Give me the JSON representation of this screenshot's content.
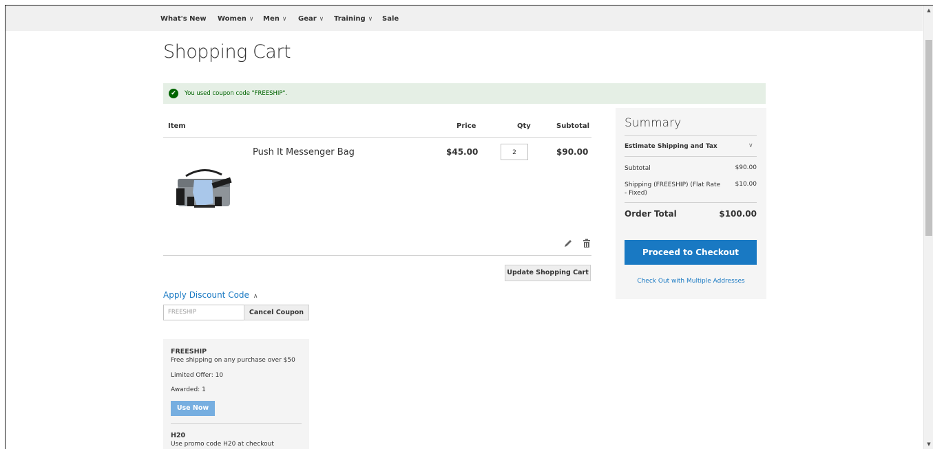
{
  "nav": {
    "items": [
      {
        "label": "What's New",
        "has_chevron": false
      },
      {
        "label": "Women",
        "has_chevron": true
      },
      {
        "label": "Men",
        "has_chevron": true
      },
      {
        "label": "Gear",
        "has_chevron": true
      },
      {
        "label": "Training",
        "has_chevron": true
      },
      {
        "label": "Sale",
        "has_chevron": false
      }
    ],
    "chevron": "∨"
  },
  "page": {
    "title": "Shopping Cart",
    "success_message": "You used coupon code \"FREESHIP\"."
  },
  "cart": {
    "headers": {
      "item": "Item",
      "price": "Price",
      "qty": "Qty",
      "subtotal": "Subtotal"
    },
    "items": [
      {
        "name": "Push It Messenger Bag",
        "price": "$45.00",
        "qty": "2",
        "subtotal": "$90.00",
        "image_icon": "messenger-bag"
      }
    ],
    "update_button": "Update Shopping Cart"
  },
  "discount": {
    "title": "Apply Discount Code",
    "coupon_value": "FREESHIP",
    "cancel_button": "Cancel Coupon",
    "chevron": "∧"
  },
  "promos": [
    {
      "code": "FREESHIP",
      "description": "Free shipping on any purchase over $50",
      "limited": "Limited Offer: 10",
      "awarded": "Awarded: 1",
      "button": "Use Now"
    },
    {
      "code": "H20",
      "description": "Use promo code H20 at checkout"
    }
  ],
  "summary": {
    "title": "Summary",
    "estimate_title": "Estimate Shipping and Tax",
    "chevron": "∨",
    "subtotal_label": "Subtotal",
    "subtotal_value": "$90.00",
    "shipping_label": "Shipping (FREESHIP) (Flat Rate - Fixed)",
    "shipping_value": "$10.00",
    "order_total_label": "Order Total",
    "order_total_value": "$100.00",
    "checkout_button": "Proceed to Checkout",
    "multi_address_link": "Check Out with Multiple Addresses"
  },
  "colors": {
    "accent": "#1979c3",
    "success_bg": "#e5efe5",
    "success_text": "#006400",
    "use_now_bg": "#76aee0"
  }
}
